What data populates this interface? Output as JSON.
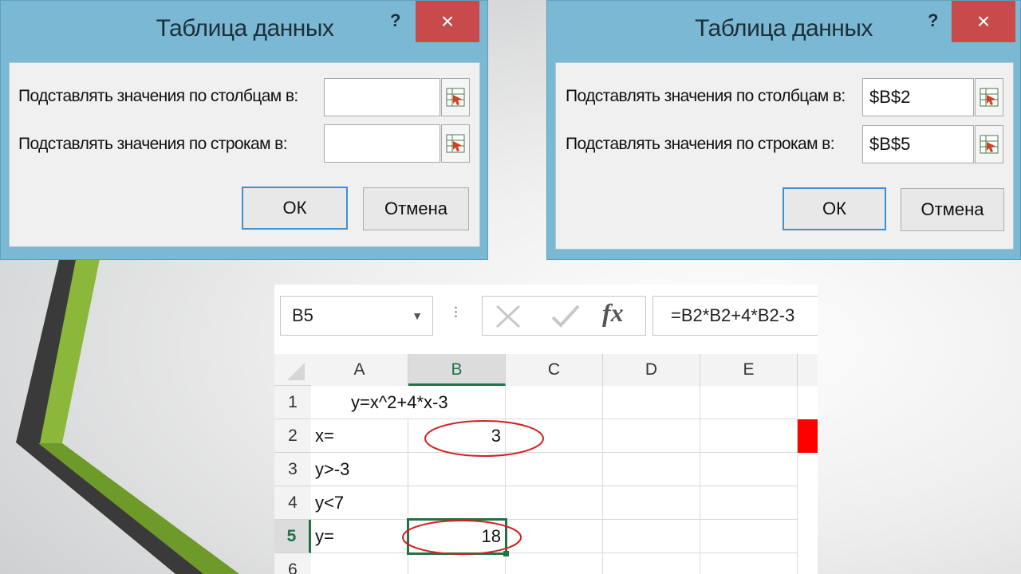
{
  "dialogs": [
    {
      "title": "Таблица данных",
      "help_icon": "?",
      "close_icon": "×",
      "row_input_label": "Подставлять значения по столбцам в:",
      "row_input_value": "",
      "col_input_label": "Подставлять значения по строкам в:",
      "col_input_value": "",
      "ok_label": "ОК",
      "cancel_label": "Отмена"
    },
    {
      "title": "Таблица данных",
      "help_icon": "?",
      "close_icon": "×",
      "row_input_label": "Подставлять значения по столбцам в:",
      "row_input_value": "$B$2",
      "col_input_label": "Подставлять значения по строкам в:",
      "col_input_value": "$B$5",
      "ok_label": "ОК",
      "cancel_label": "Отмена"
    }
  ],
  "spreadsheet": {
    "name_box": "B5",
    "formula": "=B2*B2+4*B2-3",
    "fx_label": "fx",
    "columns": [
      "A",
      "B",
      "C",
      "D",
      "E"
    ],
    "rows": [
      "1",
      "2",
      "3",
      "4",
      "5",
      "6"
    ],
    "cells": {
      "A1": "y=x^2+4*x-3",
      "A2": "x=",
      "B2": "3",
      "A3": "y>-3",
      "A4": "y<7",
      "A5": "y=",
      "B5": "18"
    },
    "selected_cell": "B5",
    "accent_color": "#217346",
    "highlight_color": "#ff0000"
  }
}
